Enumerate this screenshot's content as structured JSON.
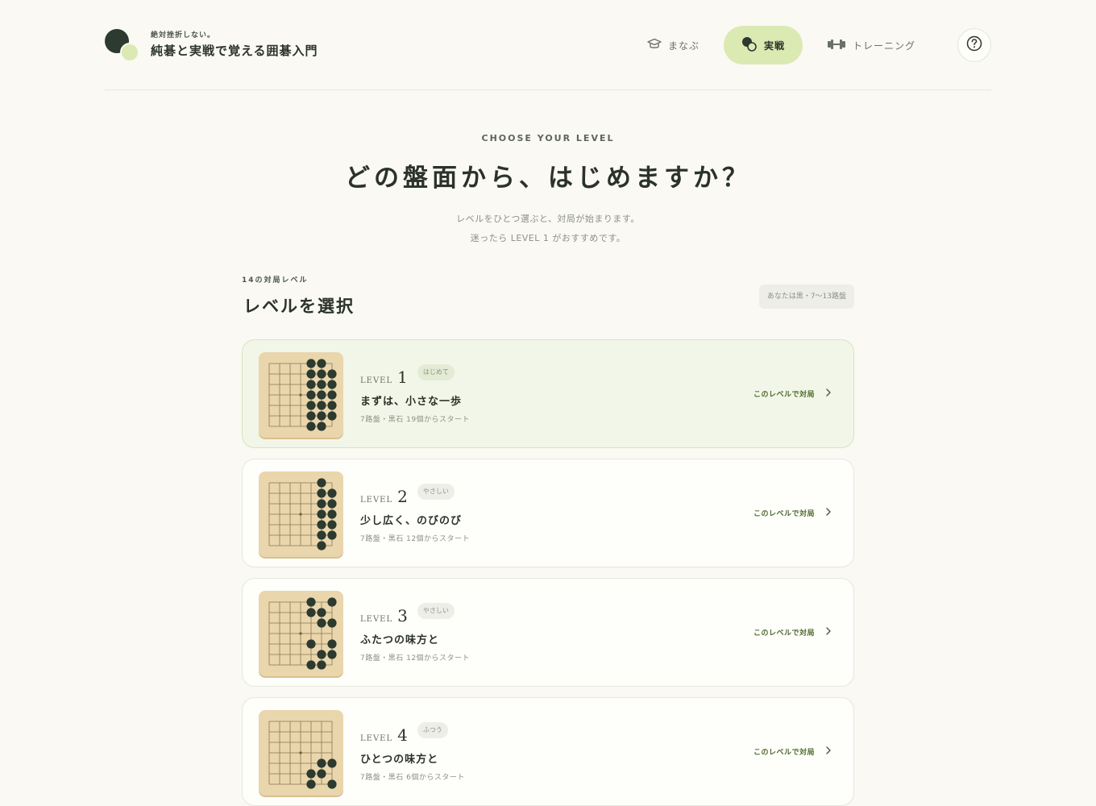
{
  "header": {
    "tagline": "絶対挫折しない。",
    "title": "純碁と実戦で覚える囲碁入門",
    "nav": [
      {
        "label": "まなぶ",
        "icon": "graduation-cap-icon",
        "active": false
      },
      {
        "label": "実戦",
        "icon": "go-stones-icon",
        "active": true
      },
      {
        "label": "トレーニング",
        "icon": "dumbbell-icon",
        "active": false
      }
    ],
    "help_icon": "question-circle-icon"
  },
  "hero": {
    "eyebrow": "CHOOSE YOUR LEVEL",
    "title": "どの盤面から、はじめますか？",
    "sub_line1": "レベルをひとつ選ぶと、対局が始まります。",
    "sub_line2": "迷ったら LEVEL 1 がおすすめです。"
  },
  "section": {
    "count": "14の対局レベル",
    "title": "レベルを選択",
    "board_info": "あなたは黒・7〜13路盤"
  },
  "levels": [
    {
      "word": "LEVEL",
      "num": "1",
      "badge": "はじめて",
      "name": "まずは、小さな一歩",
      "desc": "7路盤・黒石 19個からスタート",
      "action": "このレベルで対局",
      "selected": true,
      "stones": [
        [
          4,
          0
        ],
        [
          5,
          0
        ],
        [
          4,
          1
        ],
        [
          5,
          1
        ],
        [
          6,
          1
        ],
        [
          4,
          2
        ],
        [
          5,
          2
        ],
        [
          6,
          2
        ],
        [
          4,
          3
        ],
        [
          5,
          3
        ],
        [
          6,
          3
        ],
        [
          4,
          4
        ],
        [
          5,
          4
        ],
        [
          6,
          4
        ],
        [
          4,
          5
        ],
        [
          5,
          5
        ],
        [
          6,
          5
        ],
        [
          4,
          6
        ],
        [
          5,
          6
        ]
      ]
    },
    {
      "word": "LEVEL",
      "num": "2",
      "badge": "やさしい",
      "name": "少し広く、のびのび",
      "desc": "7路盤・黒石 12個からスタート",
      "action": "このレベルで対局",
      "selected": false,
      "stones": [
        [
          5,
          0
        ],
        [
          5,
          1
        ],
        [
          6,
          1
        ],
        [
          5,
          2
        ],
        [
          6,
          2
        ],
        [
          5,
          3
        ],
        [
          6,
          3
        ],
        [
          5,
          4
        ],
        [
          6,
          4
        ],
        [
          5,
          5
        ],
        [
          6,
          5
        ],
        [
          5,
          6
        ]
      ]
    },
    {
      "word": "LEVEL",
      "num": "3",
      "badge": "やさしい",
      "name": "ふたつの味方と",
      "desc": "7路盤・黒石 12個からスタート",
      "action": "このレベルで対局",
      "selected": false,
      "stones": [
        [
          4,
          0
        ],
        [
          6,
          0
        ],
        [
          4,
          1
        ],
        [
          5,
          1
        ],
        [
          5,
          2
        ],
        [
          6,
          2
        ],
        [
          4,
          4
        ],
        [
          6,
          4
        ],
        [
          5,
          5
        ],
        [
          6,
          5
        ],
        [
          4,
          6
        ],
        [
          5,
          6
        ]
      ]
    },
    {
      "word": "LEVEL",
      "num": "4",
      "badge": "ふつう",
      "name": "ひとつの味方と",
      "desc": "7路盤・黒石 6個からスタート",
      "action": "このレベルで対局",
      "selected": false,
      "stones": [
        [
          5,
          4
        ],
        [
          6,
          4
        ],
        [
          4,
          5
        ],
        [
          5,
          5
        ],
        [
          4,
          6
        ],
        [
          6,
          6
        ]
      ]
    }
  ]
}
